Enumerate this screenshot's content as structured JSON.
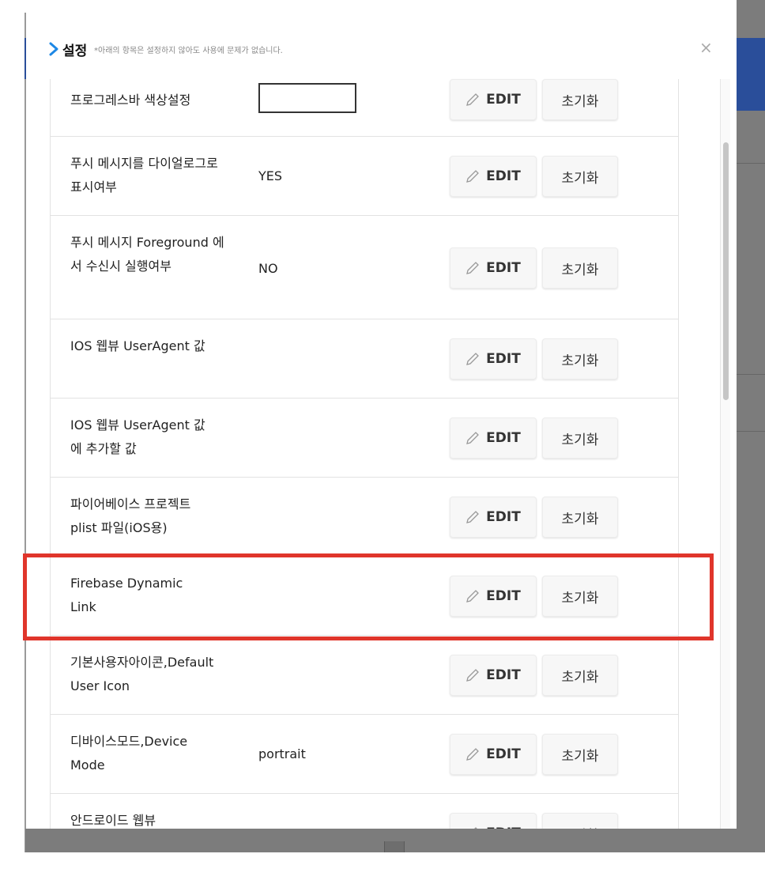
{
  "modal": {
    "title": "설정",
    "subtitle": "*아래의 항목은 설정하지 않아도 사용에 문제가 없습니다.",
    "close_symbol": "×"
  },
  "buttons": {
    "edit_label": "EDIT",
    "reset_label": "초기화"
  },
  "rows": [
    {
      "label": "프로그레스바 색상설정",
      "value": "",
      "value_type": "color-swatch"
    },
    {
      "label": "푸시 메시지를 다이얼로그로 표시여부",
      "value": "YES"
    },
    {
      "label": "푸시 메시지 Foreground 에서 수신시 실행여부",
      "value": "NO"
    },
    {
      "label": "IOS 웹뷰 UserAgent 값",
      "value": ""
    },
    {
      "label": "IOS 웹뷰 UserAgent 값에 추가할 값",
      "value": ""
    },
    {
      "label": "파이어베이스 프로젝트 plist 파일(iOS용)",
      "value": ""
    },
    {
      "label": "Firebase Dynamic Link",
      "value": "",
      "highlighted": true
    },
    {
      "label": "기본사용자아이콘,Default User Icon",
      "value": ""
    },
    {
      "label": "디바이스모드,Device Mode",
      "value": "portrait"
    },
    {
      "label": "안드로이드 웹뷰",
      "value": ""
    }
  ],
  "colors": {
    "accent_chevron": "#1e88e5",
    "highlight_border": "#e0352b",
    "navy": "#2a4e9a"
  }
}
